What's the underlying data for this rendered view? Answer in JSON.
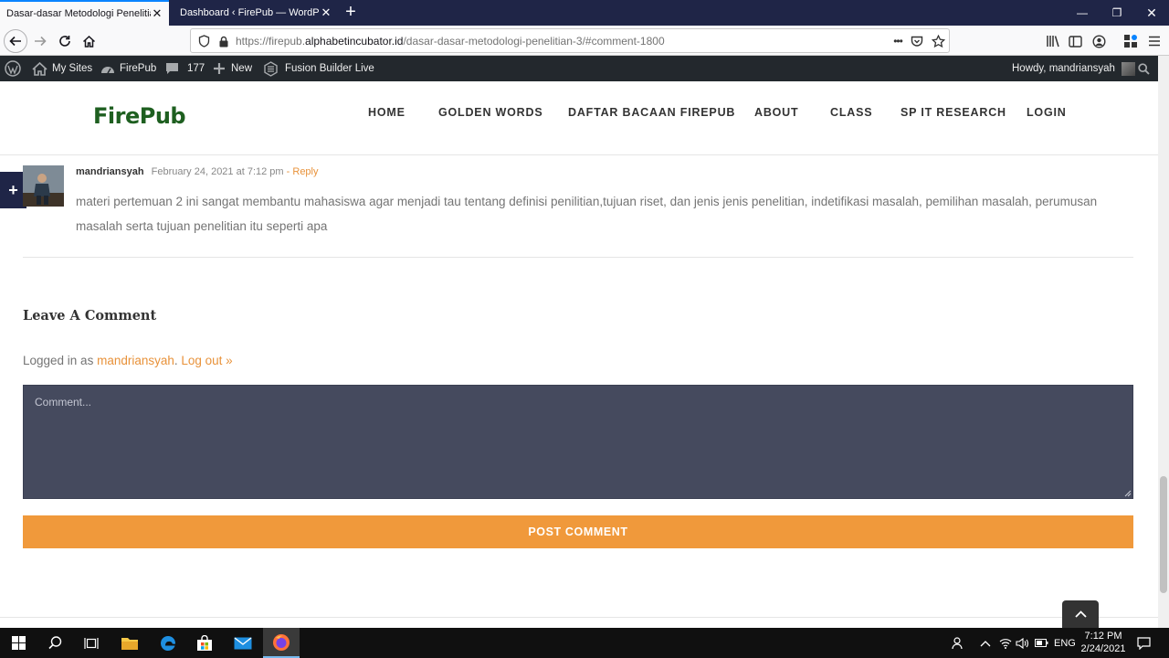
{
  "browser": {
    "tabs": [
      {
        "title": "Dasar-dasar Metodologi Penelitian",
        "active": true
      },
      {
        "title": "Dashboard ‹ FirePub — WordPress",
        "active": false
      }
    ],
    "url_prefix": "https://firepub.",
    "url_domain": "alphabetincubator.id",
    "url_path": "/dasar-dasar-metodologi-penelitian-3/#comment-1800",
    "page_actions_glyph": "•••",
    "accent": "#0a84ff"
  },
  "admin_bar": {
    "my_sites": "My Sites",
    "site_name": "FirePub",
    "comments_count": "177",
    "new_label": "New",
    "fusion": "Fusion Builder Live",
    "howdy": "Howdy, mandriansyah",
    "bg": "#23282d"
  },
  "site": {
    "logo": "FirePub",
    "logo_color": "#1e5f20",
    "menu": [
      "HOME",
      "GOLDEN WORDS",
      "DAFTAR BACAAN FIREPUB",
      "ABOUT",
      "CLASS",
      "SP IT RESEARCH",
      "LOGIN"
    ]
  },
  "comment": {
    "author": "mandriansyah",
    "date": "February 24, 2021 at 7:12 pm",
    "reply": "- Reply",
    "text": "materi pertemuan 2 ini sangat membantu mahasiswa agar menjadi tau tentang definisi penilitian,tujuan riset, dan jenis jenis penelitian, indetifikasi masalah, pemilihan masalah, perumusan masalah serta tujuan penelitian itu seperti apa"
  },
  "form": {
    "title": "Leave A Comment",
    "logged_prefix": "Logged in as ",
    "logged_user": "mandriansyah",
    "logged_sep": ". ",
    "logout": "Log out »",
    "placeholder": "Comment...",
    "submit": "POST COMMENT",
    "submit_color": "#f0993b",
    "box_color": "#454a5e"
  },
  "side_button": "+",
  "taskbar": {
    "language": "ENG",
    "time": "7:12 PM",
    "date": "2/24/2021"
  }
}
